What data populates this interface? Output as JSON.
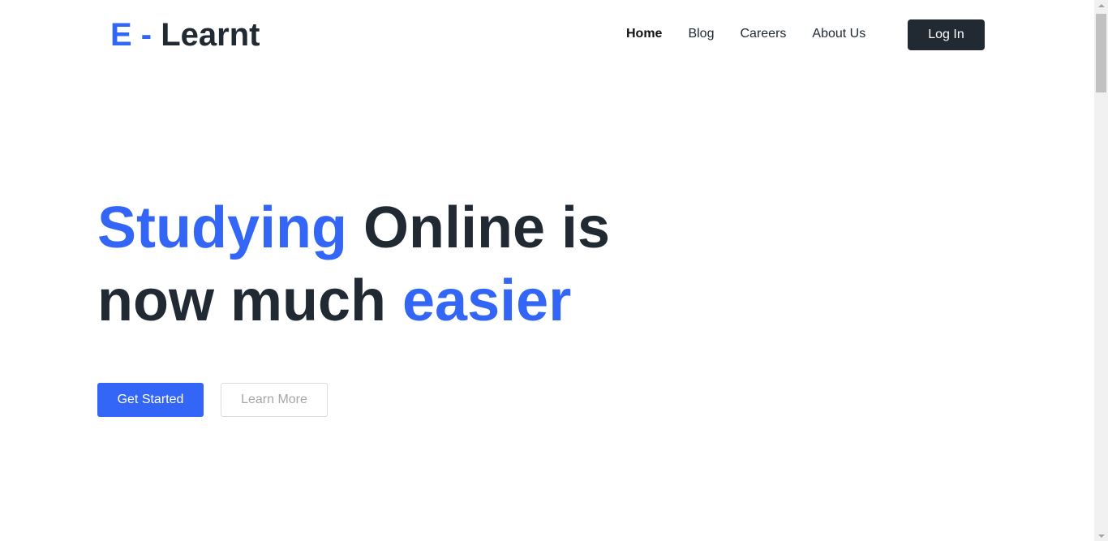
{
  "brand": {
    "prefix": "E -",
    "name": "Learnt",
    "accent_color": "#3366f6",
    "dark_color": "#212a33"
  },
  "nav": {
    "items": [
      {
        "label": "Home",
        "active": true
      },
      {
        "label": "Blog",
        "active": false
      },
      {
        "label": "Careers",
        "active": false
      },
      {
        "label": "About Us",
        "active": false
      }
    ],
    "login_label": "Log In"
  },
  "hero": {
    "title_part1": "Studying",
    "title_part2": "Online is now much",
    "title_part3": "easier",
    "primary_button": "Get Started",
    "secondary_button": "Learn More"
  },
  "scrollbar": {
    "icons": [
      "arrow-up-icon",
      "arrow-down-icon"
    ]
  }
}
